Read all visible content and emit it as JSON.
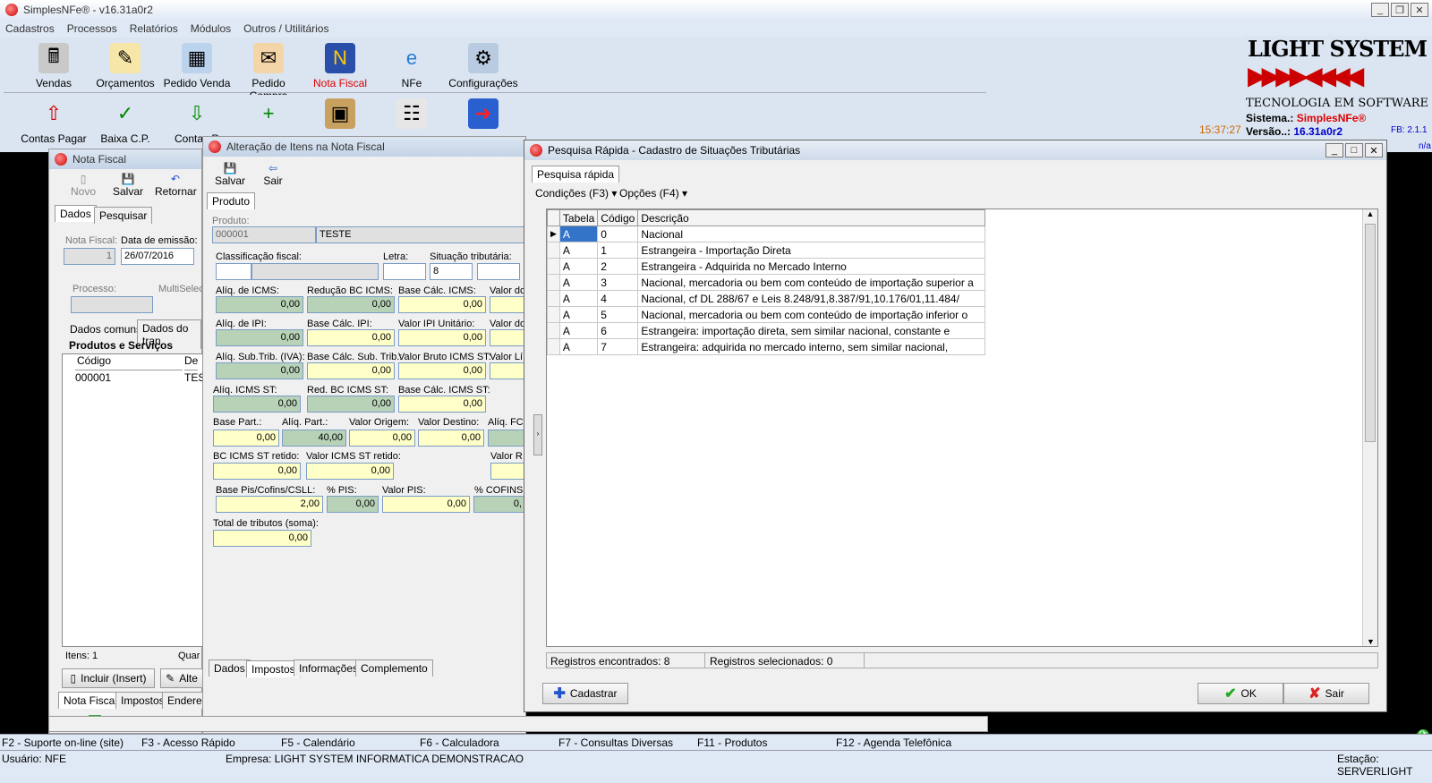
{
  "app": {
    "title": "SimplesNFe®  - v16.31a0r2"
  },
  "menu": [
    "Cadastros",
    "Processos",
    "Relatórios",
    "Módulos",
    "Outros / Utilitários"
  ],
  "toolbar1": [
    "Vendas",
    "Orçamentos",
    "Pedido Venda",
    "Pedido Compra",
    "Nota Fiscal",
    "NFe",
    "Configurações"
  ],
  "toolbar2": [
    "Contas Pagar",
    "Baixa C.P.",
    "Contas R"
  ],
  "brand": {
    "name": "LIGHT SYSTEM",
    "tagline": "TECNOLOGIA EM SOFTWARE",
    "sistema_label": "Sistema.:",
    "sistema_value": "SimplesNFe®",
    "versao_label": "Versão..:",
    "versao_value": "16.31a0r2",
    "time": "15:37:27",
    "fb": "FB: 2.1.1",
    "na": "n/a"
  },
  "nf": {
    "title": "Nota Fiscal",
    "buttons": [
      "Novo",
      "Salvar",
      "Retornar"
    ],
    "tabs": [
      "Dados",
      "Pesquisar"
    ],
    "nota_label": "Nota Fiscal:",
    "nota_value": "1",
    "data_label": "Data de emissão:",
    "data_value": "26/07/2016",
    "processo_label": "Processo:",
    "multi_label": "MultiSelec",
    "subtabs": [
      "Dados comuns",
      "Dados do tran"
    ],
    "section": "Produtos e Serviços",
    "col_codigo": "Código",
    "col_desc": "De",
    "row_codigo": "000001",
    "row_desc": "TES",
    "itens": "Itens: 1",
    "quant": "Quar",
    "incluir": "Incluir (Insert)",
    "alter": "Alte",
    "bottom_tabs": [
      "Nota Fiscal",
      "Impostos",
      "Endereç"
    ]
  },
  "alt": {
    "title": "Alteração de Itens na Nota Fiscal",
    "save": "Salvar",
    "exit": "Sair",
    "tab": "Produto",
    "produto_label": "Produto:",
    "produto_code": "000001",
    "produto_name": "TESTE",
    "class_label": "Classificação fiscal:",
    "letra_label": "Letra:",
    "sit_label": "Situação tributária:",
    "sit_value": "8",
    "fields": {
      "aliq_icms_l": "Alíq. de ICMS:",
      "aliq_icms": "0,00",
      "red_bc_l": "Redução BC ICMS:",
      "red_bc": "0,00",
      "base_icms_l": "Base Cálc. ICMS:",
      "base_icms": "0,00",
      "valor_do_l": "Valor do",
      "aliq_ipi_l": "Alíq. de IPI:",
      "aliq_ipi": "0,00",
      "base_ipi_l": "Base Cálc. IPI:",
      "base_ipi": "0,00",
      "valor_ipi_u_l": "Valor IPI Unitário:",
      "valor_ipi_u": "0,00",
      "valor_do2_l": "Valor do",
      "aliq_sub_l": "Alíq. Sub.Trib. (IVA):",
      "aliq_sub": "0,00",
      "base_sub_l": "Base Cálc. Sub. Trib.:",
      "base_sub": "0,00",
      "valor_bruto_l": "Valor Bruto ICMS ST:",
      "valor_bruto": "0,00",
      "valor_li_l": "Valor Lí",
      "aliq_st_l": "Alíq. ICMS ST:",
      "aliq_st": "0,00",
      "red_st_l": "Red. BC ICMS ST:",
      "red_st": "0,00",
      "base_st_l": "Base Cálc. ICMS ST:",
      "base_st": "0,00",
      "base_part_l": "Base Part.:",
      "base_part": "0,00",
      "aliq_part_l": "Alíq. Part.:",
      "aliq_part": "40,00",
      "valor_orig_l": "Valor Origem:",
      "valor_orig": "0,00",
      "valor_dest_l": "Valor Destino:",
      "valor_dest": "0,00",
      "aliq_fc_l": "Alíq. FC",
      "bc_ret_l": "BC ICMS ST retido:",
      "bc_ret": "0,00",
      "valor_ret_l": "Valor ICMS ST retido:",
      "valor_ret": "0,00",
      "valor_r_l": "Valor R",
      "base_pis_l": "Base Pis/Cofins/CSLL:",
      "base_pis": "2,00",
      "pis_pct_l": "% PIS:",
      "pis_pct": "0,00",
      "valor_pis_l": "Valor PIS:",
      "valor_pis": "0,00",
      "cofins_l": "% COFINS:",
      "cofins": "0,",
      "total_l": "Total de tributos (soma):",
      "total": "0,00"
    },
    "bottom_tabs": [
      "Dados",
      "Impostos",
      "Informações",
      "Complemento"
    ]
  },
  "pq": {
    "title": "Pesquisa Rápida - Cadastro de Situações Tributárias",
    "tab": "Pesquisa rápida",
    "cond": "Condições (F3)",
    "opcoes": "Opções (F4)",
    "headers": [
      "Tabela",
      "Código",
      "Descrição"
    ],
    "rows": [
      [
        "A",
        "0",
        "Nacional"
      ],
      [
        "A",
        "1",
        "Estrangeira - Importação Direta"
      ],
      [
        "A",
        "2",
        "Estrangeira - Adquirida no Mercado Interno"
      ],
      [
        "A",
        "3",
        "Nacional, mercadoria ou bem com conteúdo de importação superior a"
      ],
      [
        "A",
        "4",
        "Nacional, cf DL 288/67 e Leis 8.248/91,8.387/91,10.176/01,11.484/"
      ],
      [
        "A",
        "5",
        "Nacional, mercadoria ou bem com conteúdo de importação inferior o"
      ],
      [
        "A",
        "6",
        "Estrangeira: importação direta, sem similar nacional, constante e"
      ],
      [
        "A",
        "7",
        "Estrangeira: adquirida no mercado interno, sem similar nacional,"
      ]
    ],
    "found": "Registros encontrados: 8",
    "selected": "Registros selecionados: 0",
    "cadastrar": "Cadastrar",
    "ok": "OK",
    "sair": "Sair"
  },
  "fkeys": [
    "F2 - Suporte on-line (site)",
    "F3 - Acesso Rápido",
    "F5 - Calendário",
    "F6 - Calculadora",
    "F7 - Consultas Diversas",
    "F11 - Produtos",
    "F12 - Agenda Telefônica"
  ],
  "status": {
    "user": "Usuário: NFE",
    "empresa": "Empresa: LIGHT SYSTEM INFORMATICA DEMONSTRACAO",
    "estacao": "Estação: SERVERLIGHT"
  }
}
